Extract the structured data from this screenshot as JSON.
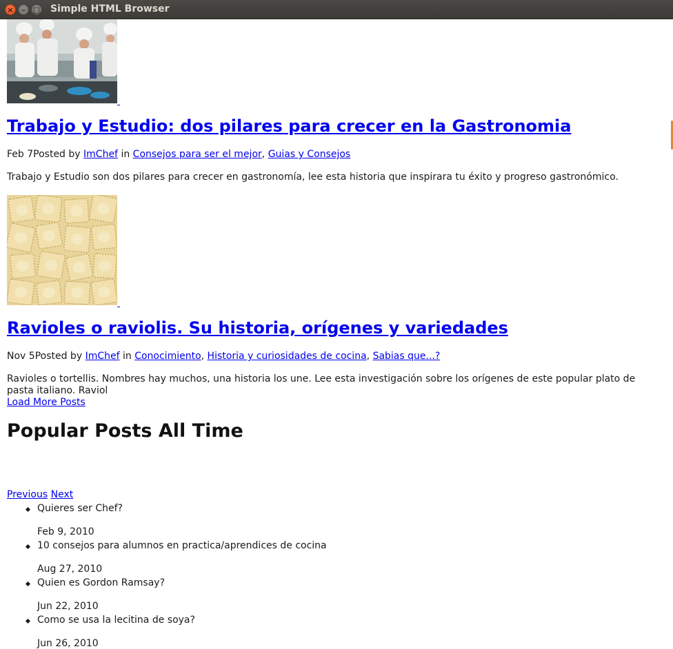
{
  "window": {
    "title": "Simple HTML Browser"
  },
  "posts": [
    {
      "title": "Trabajo y Estudio: dos pilares para crecer en la Gastronomia",
      "date": "Feb 7",
      "posted_by_label": "Posted by",
      "author": "ImChef",
      "in_label": "in",
      "categories": [
        "Consejos para ser el mejor",
        "Guias y Consejos"
      ],
      "excerpt": "Trabajo y Estudio son dos pilares para crecer en gastronomía, lee esta historia que inspirara tu éxito y progreso gastronómico."
    },
    {
      "title": "Ravioles o raviolis. Su historia, orígenes y variedades",
      "date": "Nov 5",
      "posted_by_label": "Posted by",
      "author": "ImChef",
      "in_label": "in",
      "categories": [
        "Conocimiento",
        "Historia y curiosidades de cocina",
        "Sabias que...?"
      ],
      "excerpt": "Ravioles o tortellis. Nombres hay muchos, una historia los une. Lee esta investigación sobre los orígenes de este popular plato de pasta italiano. Raviol"
    }
  ],
  "load_more_label": "Load More Posts",
  "popular": {
    "heading": "Popular Posts All Time",
    "prev_label": "Previous",
    "next_label": "Next",
    "items": [
      {
        "title": "Quieres ser Chef?",
        "date": "Feb 9, 2010"
      },
      {
        "title": "10 consejos para alumnos en practica/aprendices de cocina",
        "date": "Aug 27, 2010"
      },
      {
        "title": "Quien es Gordon Ramsay?",
        "date": "Jun 22, 2010"
      },
      {
        "title": "Como se usa la lecitina de soya?",
        "date": "Jun 26, 2010"
      }
    ]
  },
  "colors": {
    "link": "#0000ee",
    "text": "#1a1a1a",
    "titlebar": "#3c3b37",
    "close_button": "#df4a16",
    "scroll_accent": "#e4853a"
  },
  "icons": {
    "close": "close-icon",
    "minimize": "minimize-icon",
    "maximize": "maximize-icon"
  }
}
